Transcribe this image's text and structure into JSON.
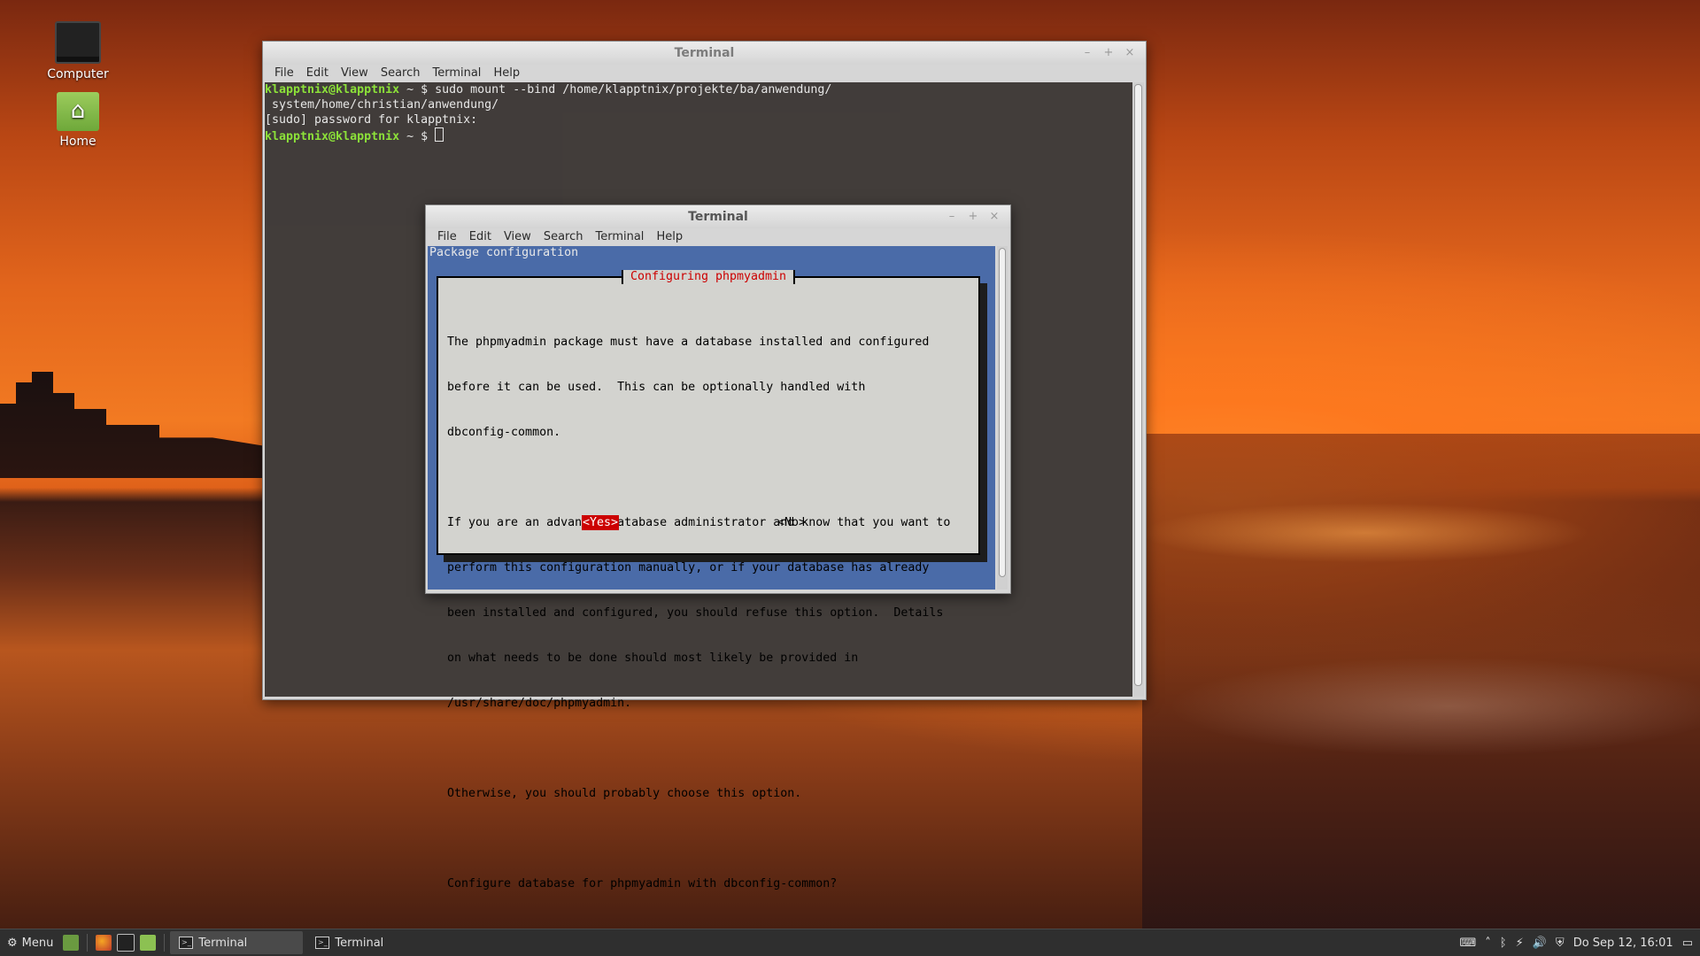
{
  "desktop": {
    "icons": [
      {
        "label": "Computer",
        "icon": "monitor-icon"
      },
      {
        "label": "Home",
        "icon": "home-folder-icon"
      }
    ]
  },
  "outer_terminal": {
    "title": "Terminal",
    "menu": [
      "File",
      "Edit",
      "View",
      "Search",
      "Terminal",
      "Help"
    ],
    "lines": [
      {
        "prompt": "klapptnix@klapptnix",
        "rest": " ~ $ sudo mount --bind /home/klapptnix/projekte/ba/anwendung/"
      },
      {
        "prompt": "",
        "rest": " system/home/christian/anwendung/"
      },
      {
        "prompt": "",
        "rest": "[sudo] password for klapptnix:"
      },
      {
        "prompt": "klapptnix@klapptnix",
        "rest": " ~ $ "
      }
    ]
  },
  "inner_terminal": {
    "title": "Terminal",
    "menu": [
      "File",
      "Edit",
      "View",
      "Search",
      "Terminal",
      "Help"
    ],
    "package_title": "Package configuration",
    "dialog": {
      "title": "Configuring phpmyadmin",
      "body": [
        "The phpmyadmin package must have a database installed and configured",
        "before it can be used.  This can be optionally handled with",
        "dbconfig-common.",
        "",
        "If you are an advanced database administrator and know that you want to",
        "perform this configuration manually, or if your database has already",
        "been installed and configured, you should refuse this option.  Details",
        "on what needs to be done should most likely be provided in",
        "/usr/share/doc/phpmyadmin.",
        "",
        "Otherwise, you should probably choose this option.",
        "",
        "Configure database for phpmyadmin with dbconfig-common?"
      ],
      "yes_label": "<Yes>",
      "no_label": "<No>"
    }
  },
  "window_controls": {
    "minimize": "–",
    "maximize": "+",
    "close": "×"
  },
  "panel": {
    "menu_label": "Menu",
    "tasks": [
      {
        "label": "Terminal",
        "active": true
      },
      {
        "label": "Terminal",
        "active": false
      }
    ],
    "clock": "Do Sep 12, 16:01"
  }
}
